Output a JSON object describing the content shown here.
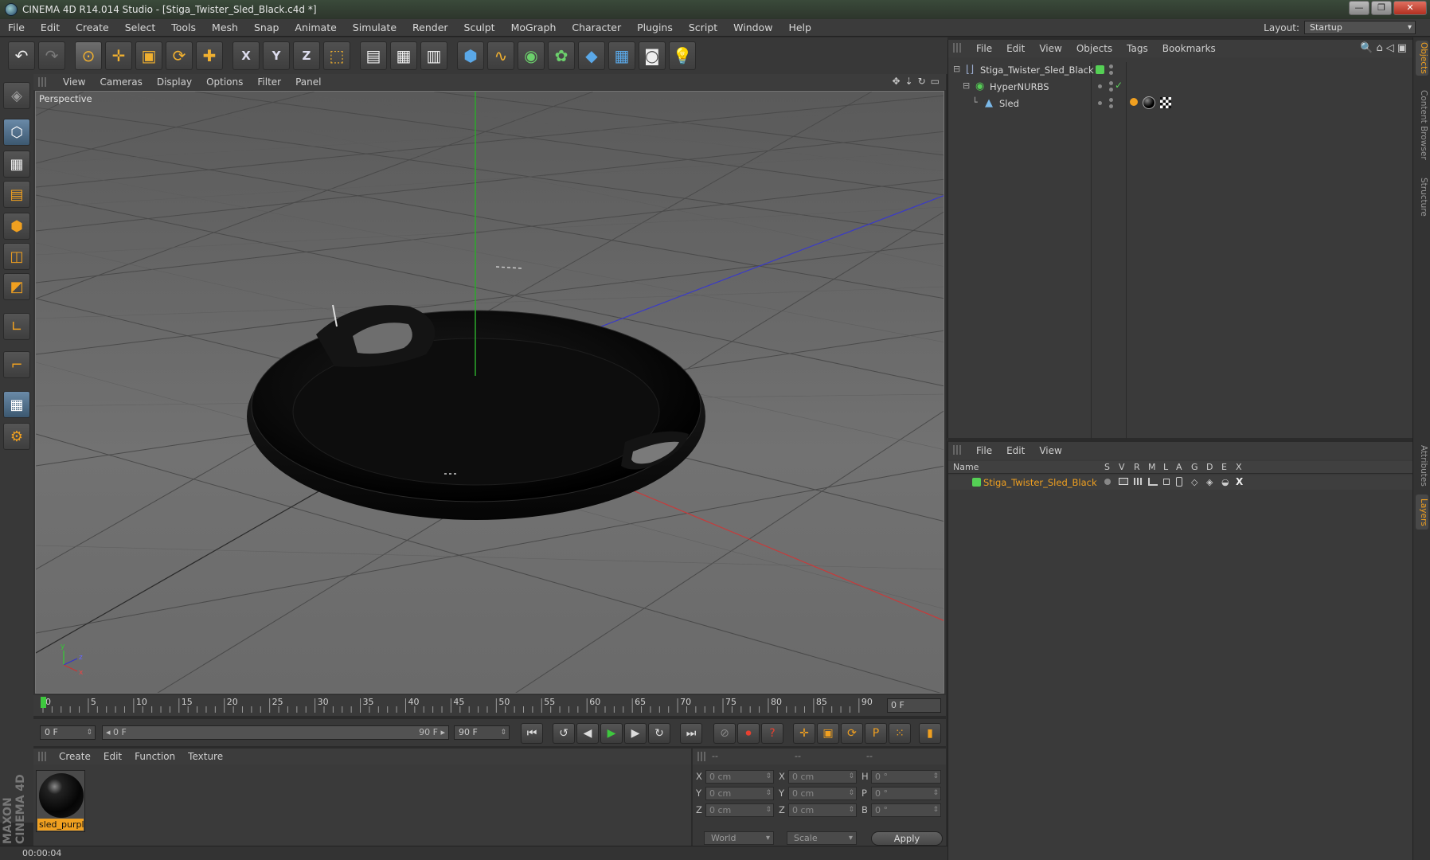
{
  "window": {
    "title": "CINEMA 4D R14.014 Studio - [Stiga_Twister_Sled_Black.c4d *]",
    "buttons": [
      "—",
      "❐",
      "✕"
    ]
  },
  "menubar": {
    "items": [
      "File",
      "Edit",
      "Create",
      "Select",
      "Tools",
      "Mesh",
      "Snap",
      "Animate",
      "Simulate",
      "Render",
      "Sculpt",
      "MoGraph",
      "Character",
      "Plugins",
      "Script",
      "Window",
      "Help"
    ],
    "layout_label": "Layout:",
    "layout_value": "Startup"
  },
  "toolbar": {
    "undo": "↶",
    "redo": "↷",
    "select": "⊙",
    "move": "✛",
    "scale": "▣",
    "rotate": "⟳",
    "add": "✚",
    "x_axis": "X",
    "y_axis": "Y",
    "z_axis": "Z",
    "coord": "⬚",
    "render_view": "▤",
    "render_pic": "▦",
    "render_settings": "▥",
    "cube": "⬢",
    "spline": "∿",
    "nurbs": "◉",
    "array": "✿",
    "deformer": "◆",
    "scene": "▦",
    "camera": "◙",
    "light": "💡"
  },
  "left_tools": [
    "◈",
    "⬡",
    "▦",
    "▤",
    "⬢",
    "◫",
    "◩",
    "∟",
    "⌐",
    "▦",
    "⚙"
  ],
  "maxon": "MAXON CINEMA 4D",
  "viewport": {
    "menu": [
      "View",
      "Cameras",
      "Display",
      "Options",
      "Filter",
      "Panel"
    ],
    "icons": [
      "✥",
      "⇣",
      "↻",
      "▭"
    ],
    "label": "Perspective"
  },
  "timeline": {
    "ticks": [
      "0",
      "5",
      "10",
      "15",
      "20",
      "25",
      "30",
      "35",
      "40",
      "45",
      "50",
      "55",
      "60",
      "65",
      "70",
      "75",
      "80",
      "85",
      "90"
    ],
    "current_frame": "0 F"
  },
  "transport": {
    "start": "0 F",
    "range_left": "◂ 0 F",
    "range_right": "90 F ▸",
    "end": "90 F",
    "buttons": {
      "to_start": "⏮",
      "prev_key": "↺",
      "prev_frame": "◀",
      "play": "▶",
      "next_frame": "▶",
      "next_key": "↻",
      "to_end": "⏭",
      "record_off": "⊘",
      "record": "⏺",
      "help": "?",
      "move_key": "✛",
      "scale_key": "▣",
      "rot_key": "⟳",
      "param_key": "P",
      "pla_key": "⁙",
      "timeline_btn": "▮"
    }
  },
  "materials": {
    "menu": [
      "Create",
      "Edit",
      "Function",
      "Texture"
    ],
    "items": [
      {
        "name": "sled_purpl"
      }
    ]
  },
  "coordinates": {
    "headers": [
      "--",
      "--",
      "--"
    ],
    "rows": [
      {
        "a": "X",
        "av": "0 cm",
        "b": "X",
        "bv": "0 cm",
        "c": "H",
        "cv": "0 °"
      },
      {
        "a": "Y",
        "av": "0 cm",
        "b": "Y",
        "bv": "0 cm",
        "c": "P",
        "cv": "0 °"
      },
      {
        "a": "Z",
        "av": "0 cm",
        "b": "Z",
        "bv": "0 cm",
        "c": "B",
        "cv": "0 °"
      }
    ],
    "space": "World",
    "mode": "Scale",
    "apply": "Apply"
  },
  "status": {
    "text": "00:00:04"
  },
  "object_manager": {
    "menu": [
      "File",
      "Edit",
      "View",
      "Objects",
      "Tags",
      "Bookmarks"
    ],
    "icons": [
      "🔍",
      "⌂",
      "◁",
      "▣"
    ],
    "objects": [
      {
        "name": "Stiga_Twister_Sled_Black",
        "tree": "⊟",
        "icon": "⌊⌋"
      },
      {
        "name": "HyperNURBS",
        "tree": "⊟",
        "icon": "◉"
      },
      {
        "name": "Sled",
        "tree": "└",
        "icon": "▲"
      }
    ],
    "checkmark": "✓"
  },
  "layer_manager": {
    "menu": [
      "File",
      "Edit",
      "View"
    ],
    "columns": [
      "Name",
      "S",
      "V",
      "R",
      "M",
      "L",
      "A",
      "G",
      "D",
      "E",
      "X"
    ],
    "layers": [
      {
        "name": "Stiga_Twister_Sled_Black"
      }
    ]
  },
  "right_tabs": [
    "Objects",
    "Content Browser",
    "Structure",
    "Attributes",
    "Layers"
  ],
  "colors": {
    "accent": "#f0a020",
    "layer_green": "#55d055",
    "viewport_bg": "#6a6a6a"
  }
}
